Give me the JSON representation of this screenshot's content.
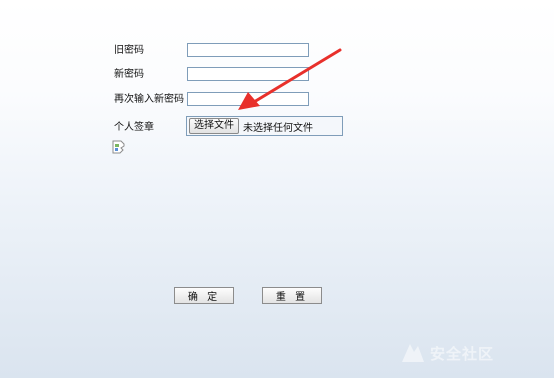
{
  "form": {
    "old_password": {
      "label": "旧密码",
      "value": ""
    },
    "new_password": {
      "label": "新密码",
      "value": ""
    },
    "confirm_password": {
      "label": "再次输入新密码",
      "value": ""
    },
    "signature": {
      "label": "个人签章",
      "button_label": "选择文件",
      "status_text": "未选择任何文件"
    },
    "broken_image_icon": "broken-image-icon",
    "submit_label": "确 定",
    "reset_label": "重 置"
  },
  "annotation": {
    "arrow_color": "#e8302b"
  },
  "watermark": {
    "text": "安全社区"
  }
}
